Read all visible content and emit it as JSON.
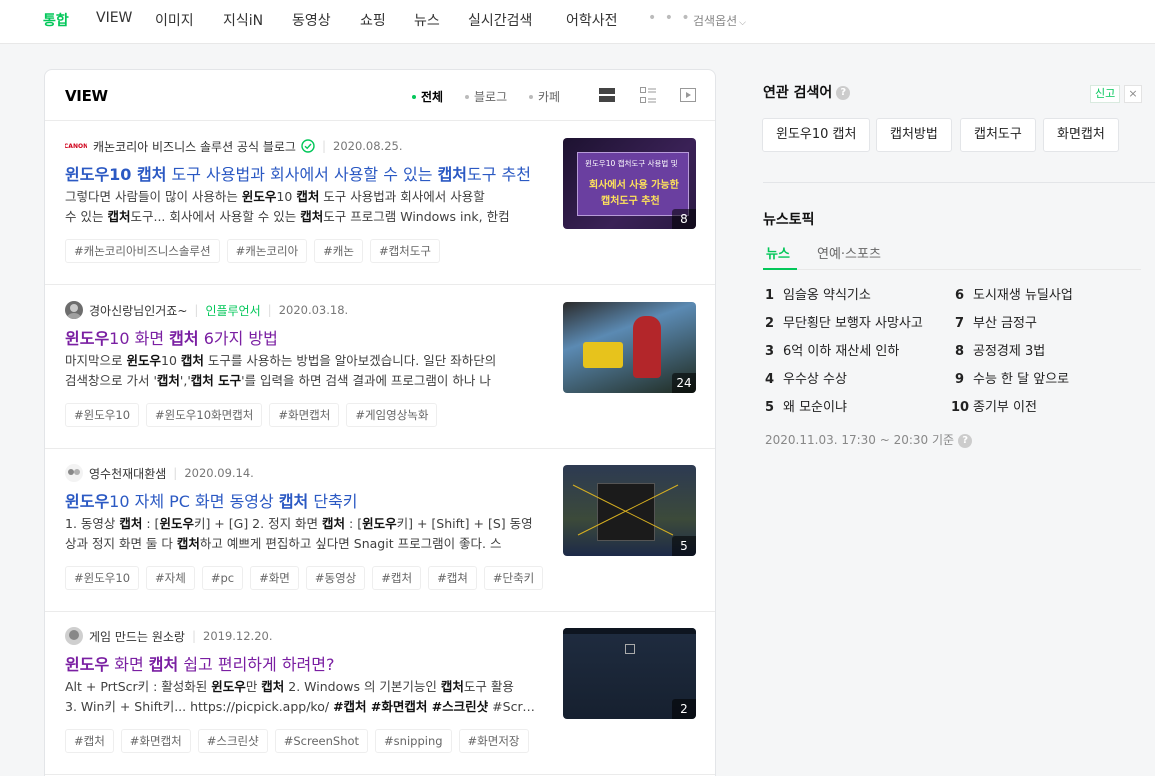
{
  "nav": {
    "tabs": [
      "통합",
      "VIEW",
      "이미지",
      "지식iN",
      "동영상",
      "쇼핑",
      "뉴스",
      "실시간검색",
      "어학사전"
    ],
    "more": "• • •",
    "search_options": "검색옵션"
  },
  "view": {
    "title": "VIEW",
    "filters": [
      "전체",
      "블로그",
      "카페"
    ],
    "items": [
      {
        "source": "캐논코리아 비즈니스 솔루션 공식 블로그",
        "badge": "",
        "date": "2020.08.25.",
        "title_parts": [
          [
            "윈도우10 캡처",
            true
          ],
          [
            " 도구 사용법과 회사에서 사용할 수 있는 ",
            false
          ],
          [
            "캡처",
            true
          ],
          [
            "도구 추천",
            false
          ]
        ],
        "desc_lines": [
          [
            [
              "그렇다면 사람들이 많이 사용하는 ",
              false
            ],
            [
              "윈도우",
              true
            ],
            [
              "10 ",
              false
            ],
            [
              "캡처",
              true
            ],
            [
              " 도구 사용법과 회사에서 사용할",
              false
            ]
          ],
          [
            [
              "수 있는 ",
              false
            ],
            [
              "캡처",
              true
            ],
            [
              "도구... 회사에서 사용할 수 있는 ",
              false
            ],
            [
              "캡처",
              true
            ],
            [
              "도구 프로그램 Windows ink, 한컴",
              false
            ]
          ]
        ],
        "tags": [
          "#캐논코리아비즈니스솔루션",
          "#캐논코리아",
          "#캐논",
          "#캡처도구"
        ],
        "thumb_count": "8",
        "thumb_text": [
          "윈도우10 캡처도구 사용법 및",
          "회사에서 사용 가능한",
          "캡처도구 추천"
        ]
      },
      {
        "source": "경아신랑님인거죠~",
        "badge": "인플루언서",
        "date": "2020.03.18.",
        "title_parts": [
          [
            "윈도우",
            true
          ],
          [
            "10 화면 ",
            false
          ],
          [
            "캡처",
            true
          ],
          [
            " 6가지 방법",
            false
          ]
        ],
        "desc_lines": [
          [
            [
              "마지막으로 ",
              false
            ],
            [
              "윈도우",
              true
            ],
            [
              "10 ",
              false
            ],
            [
              "캡처",
              true
            ],
            [
              " 도구를 사용하는 방법을 알아보겠습니다. 일단 좌하단의",
              false
            ]
          ],
          [
            [
              "검색창으로 가서 '",
              false
            ],
            [
              "캡처",
              true
            ],
            [
              "','",
              false
            ],
            [
              "캡처 도구",
              true
            ],
            [
              "'를 입력을 하면 검색 결과에 프로그램이 하나 나",
              false
            ]
          ]
        ],
        "tags": [
          "#윈도우10",
          "#윈도우10화면캡처",
          "#화면캡처",
          "#게임영상녹화"
        ],
        "thumb_count": "24",
        "thumb_text": []
      },
      {
        "source": "영수천재대환샘",
        "badge": "",
        "date": "2020.09.14.",
        "title_parts": [
          [
            "윈도우",
            true
          ],
          [
            "10 자체 PC 화면 동영상 ",
            false
          ],
          [
            "캡처",
            true
          ],
          [
            " 단축키",
            false
          ]
        ],
        "desc_lines": [
          [
            [
              "1. 동영상 ",
              false
            ],
            [
              "캡처",
              true
            ],
            [
              " : [",
              false
            ],
            [
              "윈도우",
              true
            ],
            [
              "키] + [G] 2. 정지 화면 ",
              false
            ],
            [
              "캡처",
              true
            ],
            [
              " : [",
              false
            ],
            [
              "윈도우",
              true
            ],
            [
              "키] + [Shift] + [S] 동영",
              false
            ]
          ],
          [
            [
              "상과 정지 화면 둘 다 ",
              false
            ],
            [
              "캡처",
              true
            ],
            [
              "하고 예쁘게 편집하고 싶다면 Snagit 프로그램이 좋다. 스",
              false
            ]
          ]
        ],
        "tags": [
          "#윈도우10",
          "#자체",
          "#pc",
          "#화면",
          "#동영상",
          "#캡처",
          "#캡쳐",
          "#단축키"
        ],
        "thumb_count": "5",
        "thumb_text": []
      },
      {
        "source": "게임 만드는 원소랑",
        "badge": "",
        "date": "2019.12.20.",
        "title_parts": [
          [
            "윈도우",
            true
          ],
          [
            " 화면 ",
            false
          ],
          [
            "캡처",
            true
          ],
          [
            " 쉽고 편리하게 하려면?",
            false
          ]
        ],
        "desc_lines": [
          [
            [
              "Alt + PrtScr키 : 활성화된 ",
              false
            ],
            [
              "윈도우",
              true
            ],
            [
              "만 ",
              false
            ],
            [
              "캡처",
              true
            ],
            [
              " 2. Windows 의 기본기능인 ",
              false
            ],
            [
              "캡처",
              true
            ],
            [
              "도구 활용",
              false
            ]
          ],
          [
            [
              "3. Win키 + Shift키... https://picpick.app/ko/ ",
              false
            ],
            [
              "#캡처 #화면캡처 #스크린샷",
              true
            ],
            [
              " #ScreenShot",
              false
            ]
          ]
        ],
        "tags": [
          "#캡처",
          "#화면캡처",
          "#스크린샷",
          "#ScreenShot",
          "#snipping",
          "#화면저장"
        ],
        "thumb_count": "2",
        "thumb_text": []
      }
    ]
  },
  "related": {
    "title": "연관 검색어",
    "help": "?",
    "report": "신고",
    "close": "×",
    "chips": [
      "윈도우10 캡처",
      "캡처방법",
      "캡처도구",
      "화면캡처"
    ]
  },
  "news_topic": {
    "title": "뉴스토픽",
    "tabs": [
      "뉴스",
      "연예·스포츠"
    ],
    "items": [
      {
        "rank": "1",
        "text": "임슬옹 약식기소"
      },
      {
        "rank": "2",
        "text": "무단횡단 보행자 사망사고"
      },
      {
        "rank": "3",
        "text": "6억 이하 재산세 인하"
      },
      {
        "rank": "4",
        "text": "우수상 수상"
      },
      {
        "rank": "5",
        "text": "왜 모순이냐"
      },
      {
        "rank": "6",
        "text": "도시재생 뉴딜사업"
      },
      {
        "rank": "7",
        "text": "부산 금정구"
      },
      {
        "rank": "8",
        "text": "공정경제 3법"
      },
      {
        "rank": "9",
        "text": "수능 한 달 앞으로"
      },
      {
        "rank": "10",
        "text": "종기부 이전"
      }
    ],
    "time": "2020.11.03. 17:30 ~ 20:30 기준"
  },
  "colors": {
    "accent": "#03c75a",
    "link": "#2b59c3",
    "visited": "#7a1fa2"
  }
}
